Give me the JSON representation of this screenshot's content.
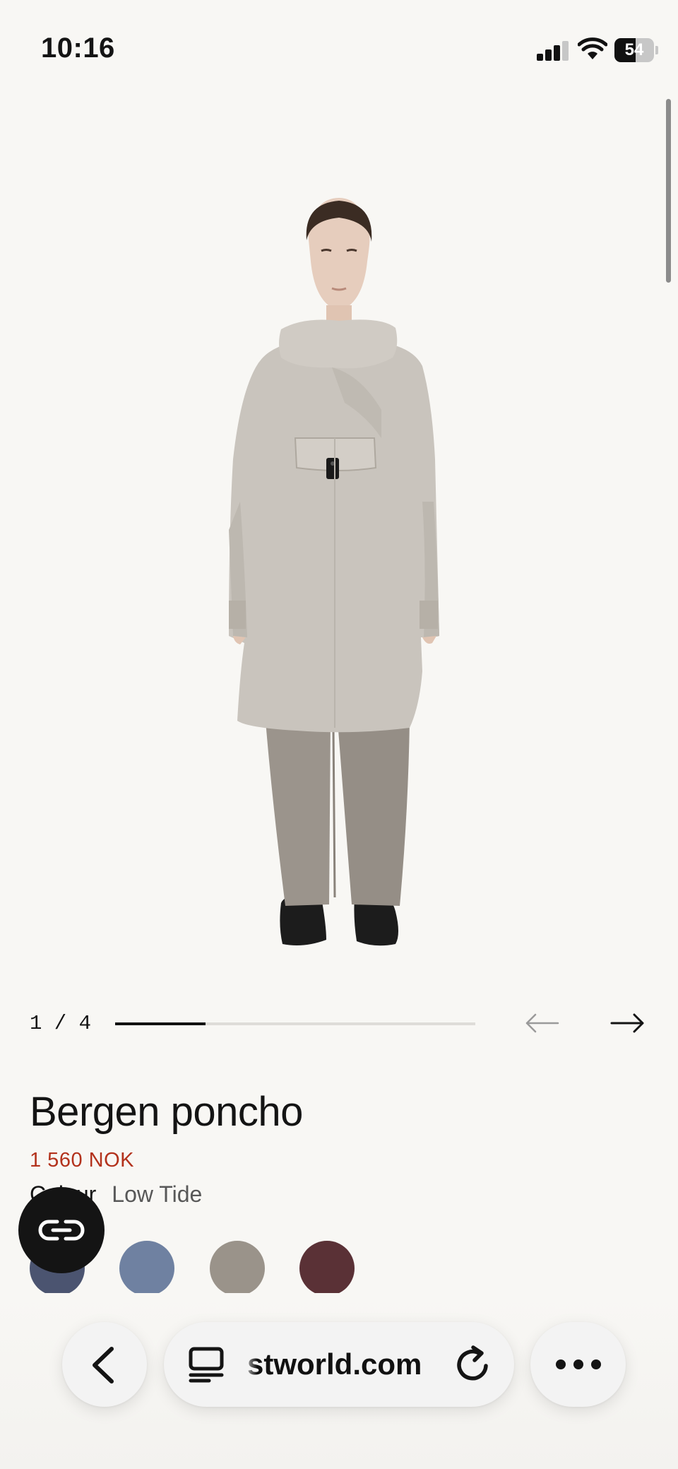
{
  "status_bar": {
    "time": "10:16",
    "battery": "54",
    "battery_level": 0.54,
    "signal_bars": 3
  },
  "gallery": {
    "counter": "1 / 4",
    "current": 1,
    "total": 4,
    "progress": 0.25,
    "prev_icon": "arrow-left-icon",
    "next_icon": "arrow-right-icon"
  },
  "product": {
    "title": "Bergen poncho",
    "price": "1 560 NOK",
    "colour_label": "Colour",
    "colour_value": "Low Tide"
  },
  "swatches": [
    {
      "name": "navy",
      "color": "#4b5470"
    },
    {
      "name": "blue",
      "color": "#6f81a1"
    },
    {
      "name": "low-tide",
      "color": "#9a938a"
    },
    {
      "name": "burgundy",
      "color": "#5a3136"
    }
  ],
  "chat_button": {
    "icon": "chat-link-icon"
  },
  "browser": {
    "url": "stworld.com",
    "back_icon": "chevron-left-icon",
    "tabs_icon": "page-menu-icon",
    "reload_icon": "reload-icon",
    "more_icon": "more-dots-icon"
  },
  "colors": {
    "background": "#f8f7f4",
    "price": "#b3321c",
    "poncho": "#c9c4bd"
  }
}
